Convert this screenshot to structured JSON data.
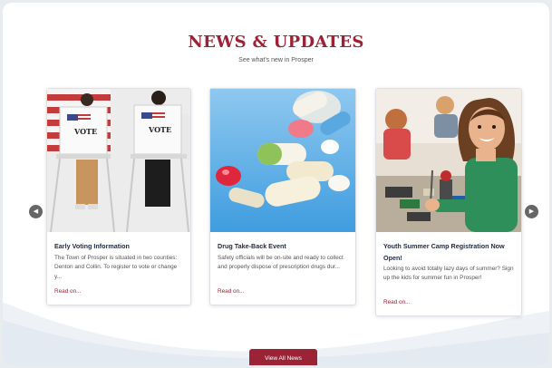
{
  "section": {
    "title": "NEWS & UPDATES",
    "subtitle": "See what's new in Prosper"
  },
  "cards": [
    {
      "title": "Early Voting Information",
      "text": "The Town of Prosper is situated in two counties: Denton and Collin. To register to vote or change y...",
      "link": "Read on...",
      "image": "voting-booths-image",
      "booth_sign": "VOTE"
    },
    {
      "title": "Drug Take-Back Event",
      "text": "Safety officials will be on-site and ready to collect and properly dispose of prescription drugs dur...",
      "link": "Read on...",
      "image": "pills-image"
    },
    {
      "title": "Youth Summer Camp Registration Now Open!",
      "text": "Looking to avoid totally lazy days of summer? Sign up the kids for summer fun in Prosper!",
      "link": "Read on...",
      "image": "kids-robotics-image"
    }
  ],
  "carousel": {
    "prev_icon": "chevron-left-icon",
    "next_icon": "chevron-right-icon"
  },
  "view_all_label": "View All News",
  "colors": {
    "accent": "#9b2335",
    "heading": "#1f2a44"
  }
}
